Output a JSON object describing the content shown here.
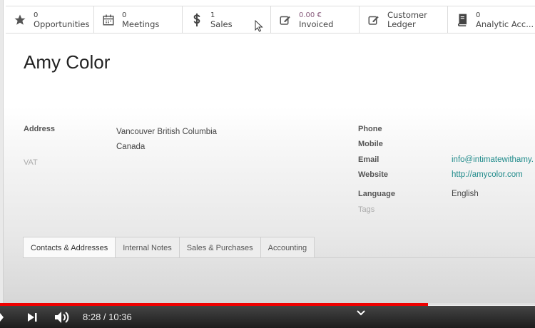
{
  "smart_buttons": [
    {
      "value": "0",
      "label": "Opportunities",
      "icon": "star-icon"
    },
    {
      "value": "0",
      "label": "Meetings",
      "icon": "calendar-icon"
    },
    {
      "value": "1",
      "label": "Sales",
      "icon": "dollar-icon"
    },
    {
      "value": "0.00 €",
      "label": "Invoiced",
      "icon": "edit-icon"
    },
    {
      "value": "",
      "label_line1": "Customer",
      "label_line2": "Ledger",
      "icon": "edit-icon"
    },
    {
      "value": "0",
      "label": "Analytic Acc...",
      "icon": "book-icon"
    }
  ],
  "partner": {
    "name": "Amy Color"
  },
  "fields": {
    "address_label": "Address",
    "address_line1": "Vancouver  British Columbia",
    "address_line2": "Canada",
    "vat_label": "VAT",
    "phone_label": "Phone",
    "mobile_label": "Mobile",
    "email_label": "Email",
    "email_value": "info@intimatewithamy.",
    "website_label": "Website",
    "website_value": "http://amycolor.com",
    "language_label": "Language",
    "language_value": "English",
    "tags_label": "Tags"
  },
  "tabs": [
    "Contacts & Addresses",
    "Internal Notes",
    "Sales & Purchases",
    "Accounting"
  ],
  "player": {
    "time": "8:28 / 10:36",
    "progress": 0.8,
    "progress_color": "#ee0000"
  }
}
